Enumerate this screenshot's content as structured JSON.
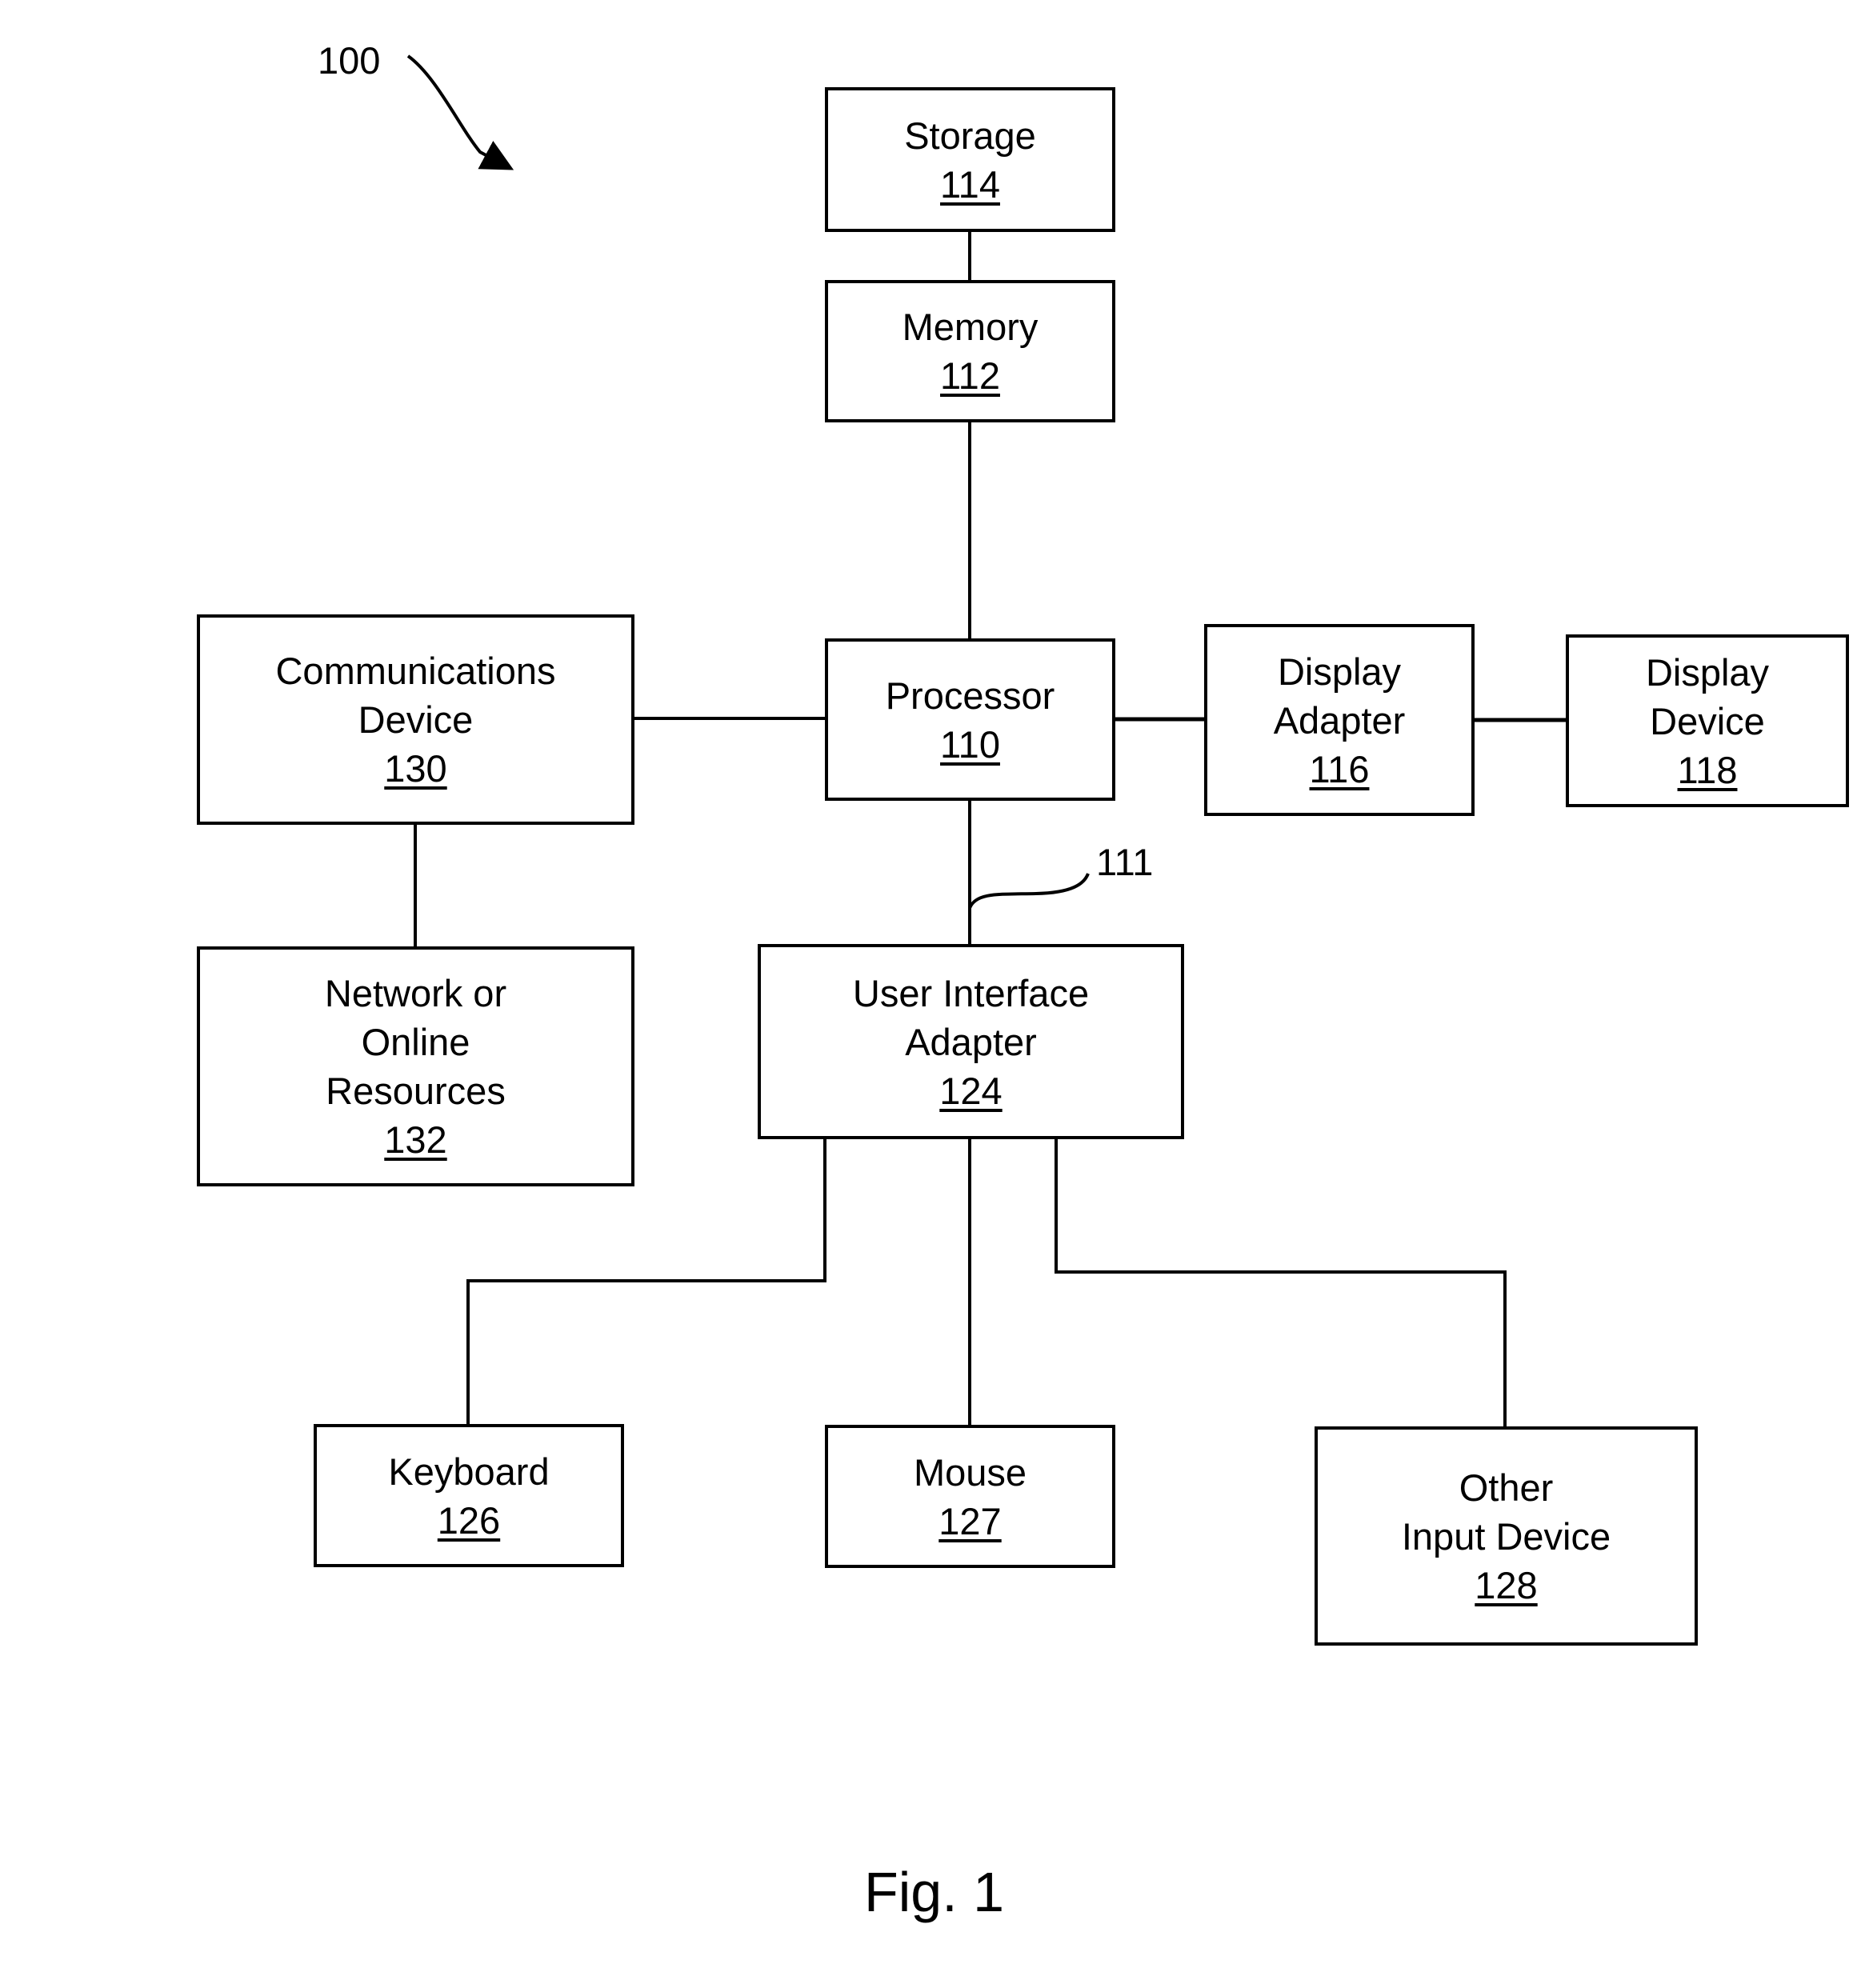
{
  "figure": {
    "caption": "Fig. 1",
    "system_ref": "100",
    "bus_ref": "111"
  },
  "boxes": {
    "storage": {
      "lines": [
        "Storage"
      ],
      "ref": "114"
    },
    "memory": {
      "lines": [
        "Memory"
      ],
      "ref": "112"
    },
    "processor": {
      "lines": [
        "Processor"
      ],
      "ref": "110"
    },
    "communications_device": {
      "lines": [
        "Communications",
        "Device"
      ],
      "ref": "130"
    },
    "display_adapter": {
      "lines": [
        "Display",
        "Adapter"
      ],
      "ref": "116"
    },
    "display_device": {
      "lines": [
        "Display",
        "Device"
      ],
      "ref": "118"
    },
    "network_resources": {
      "lines": [
        "Network or",
        "Online",
        "Resources"
      ],
      "ref": "132"
    },
    "user_interface_adapter": {
      "lines": [
        "User Interface",
        "Adapter"
      ],
      "ref": "124"
    },
    "keyboard": {
      "lines": [
        "Keyboard"
      ],
      "ref": "126"
    },
    "mouse": {
      "lines": [
        "Mouse"
      ],
      "ref": "127"
    },
    "other_input_device": {
      "lines": [
        "Other",
        "Input Device"
      ],
      "ref": "128"
    }
  },
  "connections": [
    [
      "storage",
      "memory"
    ],
    [
      "memory",
      "processor"
    ],
    [
      "processor",
      "communications_device"
    ],
    [
      "processor",
      "display_adapter"
    ],
    [
      "display_adapter",
      "display_device"
    ],
    [
      "communications_device",
      "network_resources"
    ],
    [
      "processor",
      "user_interface_adapter"
    ],
    [
      "user_interface_adapter",
      "keyboard"
    ],
    [
      "user_interface_adapter",
      "mouse"
    ],
    [
      "user_interface_adapter",
      "other_input_device"
    ]
  ]
}
